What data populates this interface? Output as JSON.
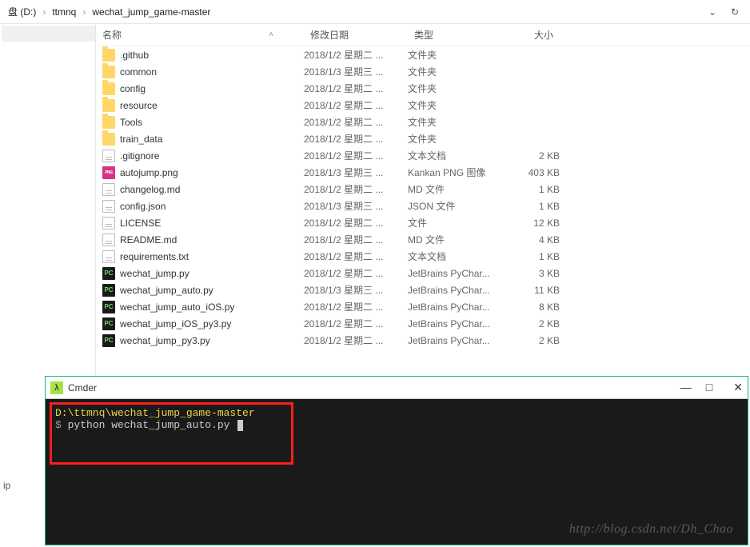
{
  "breadcrumb": {
    "segments": [
      "盘 (D:)",
      "ttmnq",
      "wechat_jump_game-master"
    ]
  },
  "columns": {
    "name": "名称",
    "date": "修改日期",
    "type": "类型",
    "size": "大小"
  },
  "sidebar_clip_text": "ip",
  "files": [
    {
      "name": ".github",
      "date": "2018/1/2 星期二 ...",
      "type": "文件夹",
      "size": "",
      "icon": "folder"
    },
    {
      "name": "common",
      "date": "2018/1/3 星期三 ...",
      "type": "文件夹",
      "size": "",
      "icon": "folder"
    },
    {
      "name": "config",
      "date": "2018/1/2 星期二 ...",
      "type": "文件夹",
      "size": "",
      "icon": "folder"
    },
    {
      "name": "resource",
      "date": "2018/1/2 星期二 ...",
      "type": "文件夹",
      "size": "",
      "icon": "folder"
    },
    {
      "name": "Tools",
      "date": "2018/1/2 星期二 ...",
      "type": "文件夹",
      "size": "",
      "icon": "folder"
    },
    {
      "name": "train_data",
      "date": "2018/1/2 星期二 ...",
      "type": "文件夹",
      "size": "",
      "icon": "folder"
    },
    {
      "name": ".gitignore",
      "date": "2018/1/2 星期二 ...",
      "type": "文本文档",
      "size": "2 KB",
      "icon": "txt"
    },
    {
      "name": "autojump.png",
      "date": "2018/1/3 星期三 ...",
      "type": "Kankan PNG 图像",
      "size": "403 KB",
      "icon": "png"
    },
    {
      "name": "changelog.md",
      "date": "2018/1/2 星期二 ...",
      "type": "MD 文件",
      "size": "1 KB",
      "icon": "txt"
    },
    {
      "name": "config.json",
      "date": "2018/1/3 星期三 ...",
      "type": "JSON 文件",
      "size": "1 KB",
      "icon": "txt"
    },
    {
      "name": "LICENSE",
      "date": "2018/1/2 星期二 ...",
      "type": "文件",
      "size": "12 KB",
      "icon": "txt"
    },
    {
      "name": "README.md",
      "date": "2018/1/2 星期二 ...",
      "type": "MD 文件",
      "size": "4 KB",
      "icon": "txt"
    },
    {
      "name": "requirements.txt",
      "date": "2018/1/2 星期二 ...",
      "type": "文本文档",
      "size": "1 KB",
      "icon": "txt"
    },
    {
      "name": "wechat_jump.py",
      "date": "2018/1/2 星期二 ...",
      "type": "JetBrains PyChar...",
      "size": "3 KB",
      "icon": "py"
    },
    {
      "name": "wechat_jump_auto.py",
      "date": "2018/1/3 星期三 ...",
      "type": "JetBrains PyChar...",
      "size": "11 KB",
      "icon": "py"
    },
    {
      "name": "wechat_jump_auto_iOS.py",
      "date": "2018/1/2 星期二 ...",
      "type": "JetBrains PyChar...",
      "size": "8 KB",
      "icon": "py"
    },
    {
      "name": "wechat_jump_iOS_py3.py",
      "date": "2018/1/2 星期二 ...",
      "type": "JetBrains PyChar...",
      "size": "2 KB",
      "icon": "py"
    },
    {
      "name": "wechat_jump_py3.py",
      "date": "2018/1/2 星期二 ...",
      "type": "JetBrains PyChar...",
      "size": "2 KB",
      "icon": "py"
    }
  ],
  "cmder": {
    "title": "Cmder",
    "cwd": "D:\\ttmnq\\wechat_jump_game-master",
    "prompt": "$",
    "command": "python wechat_jump_auto.py",
    "minimize": "—",
    "maximize": "□",
    "close": "✕"
  },
  "watermark": "http://blog.csdn.net/Dh_Chao"
}
